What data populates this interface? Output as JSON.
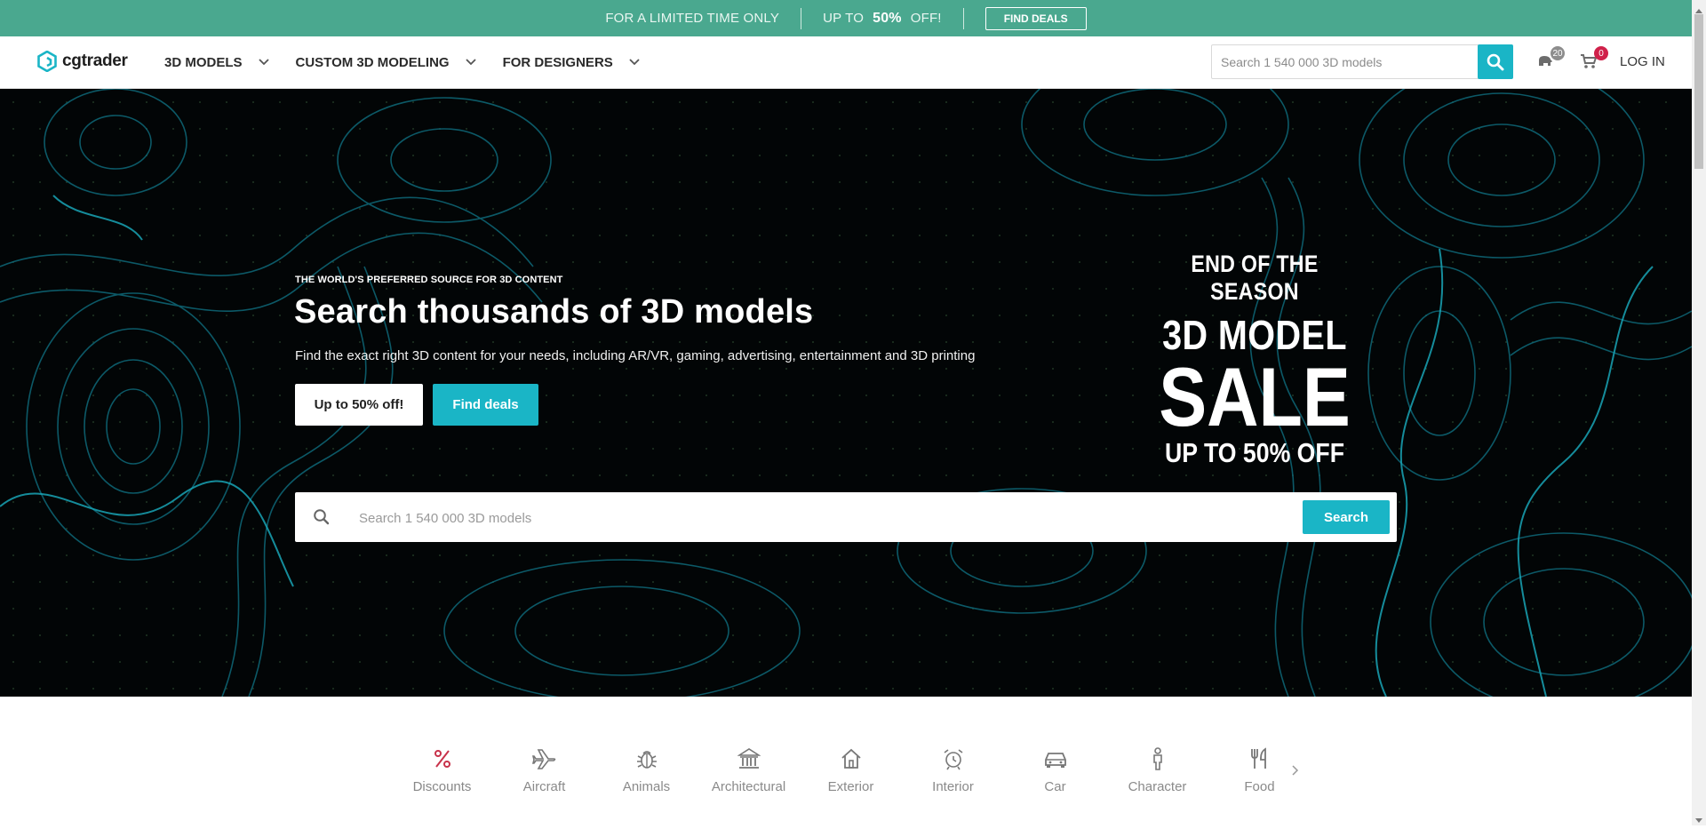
{
  "promo": {
    "limited": "FOR A LIMITED TIME ONLY",
    "up_to": "UP TO",
    "percent": "50%",
    "off": "OFF!",
    "button": "FIND DEALS"
  },
  "header": {
    "logo": "cgtrader",
    "nav": [
      "3D MODELS",
      "CUSTOM 3D MODELING",
      "FOR DESIGNERS"
    ],
    "search_placeholder": "Search 1 540 000 3D models",
    "likes_count": "20",
    "cart_count": "0",
    "login": "LOG IN"
  },
  "hero": {
    "eyebrow": "THE WORLD'S PREFERRED SOURCE FOR 3D CONTENT",
    "title": "Search thousands of 3D models",
    "subtitle": "Find the exact right 3D content for your needs, including AR/VR, gaming, advertising, entertainment and 3D printing",
    "btn_offer": "Up to 50% off!",
    "btn_deals": "Find deals",
    "sale": {
      "line1": "END OF THE SEASON",
      "line2": "3D MODEL",
      "line3": "SALE",
      "line4": "UP TO 50% OFF"
    },
    "search_placeholder": "Search 1 540 000 3D models",
    "search_button": "Search"
  },
  "categories": [
    {
      "label": "Discounts",
      "icon": "percent-icon"
    },
    {
      "label": "Aircraft",
      "icon": "airplane-icon"
    },
    {
      "label": "Animals",
      "icon": "bug-icon"
    },
    {
      "label": "Architectural",
      "icon": "building-icon"
    },
    {
      "label": "Exterior",
      "icon": "house-icon"
    },
    {
      "label": "Interior",
      "icon": "alarm-clock-icon"
    },
    {
      "label": "Car",
      "icon": "car-icon"
    },
    {
      "label": "Character",
      "icon": "person-icon"
    },
    {
      "label": "Food",
      "icon": "cutlery-icon"
    }
  ],
  "colors": {
    "promo_bg": "#4aa88f",
    "accent": "#1ab5c6",
    "hero_bg": "#020506",
    "discount_icon": "#c8324a",
    "badge_likes": "#8d8d8d",
    "badge_cart": "#d0214a"
  }
}
